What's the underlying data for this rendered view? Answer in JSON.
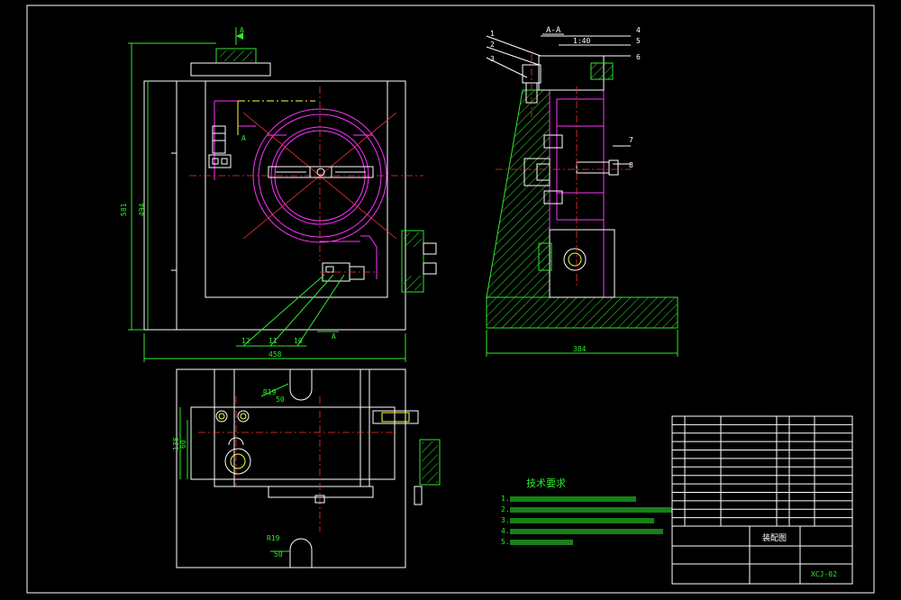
{
  "drawing": {
    "dimensions": {
      "overall_height": "581",
      "inner_height": "494",
      "main_width": "458",
      "side_width": "384",
      "plan_depth": "138",
      "plan_inner": "60"
    },
    "radii": {
      "top_slot": "R19",
      "top_slot_sub": "50",
      "bottom_slot": "R19",
      "bottom_slot_sub": "50"
    },
    "section_marks": {
      "front_top": "A",
      "front_bottom": "A",
      "front_mid": "A",
      "side_title": "A-A",
      "side_note": "1:40"
    },
    "front_leaders": [
      "12",
      "11",
      "10"
    ],
    "side_leaders_left": [
      "1",
      "2",
      "3"
    ],
    "side_leaders_right": [
      "4",
      "5",
      "6",
      "7",
      "8"
    ],
    "tech_requirements": {
      "title": "技术要求",
      "lines": [
        "1.",
        "2.",
        "3.",
        "4.",
        "5."
      ]
    },
    "title_block": {
      "name": "装配图",
      "drawing_no": "XCJ-02"
    },
    "parts_table": {
      "rows": 13
    }
  }
}
